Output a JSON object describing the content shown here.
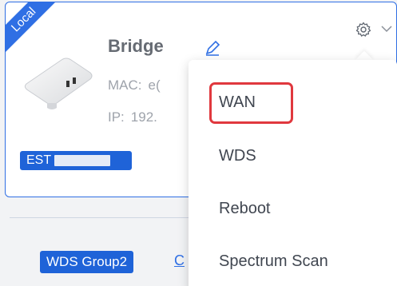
{
  "card": {
    "ribbon_label": "Local",
    "device_name": "Bridge",
    "mac_label": "MAC:",
    "mac_value": "e(",
    "ip_label": "IP:",
    "ip_value": "192.",
    "est_label": "EST"
  },
  "group": {
    "badge_label": "WDS Group2",
    "link_text": "C",
    "right_text": "£"
  },
  "menu": {
    "items": [
      {
        "label": "WAN"
      },
      {
        "label": "WDS"
      },
      {
        "label": "Reboot"
      },
      {
        "label": "Spectrum Scan"
      }
    ]
  },
  "icons": {
    "settings": "gear-icon",
    "expand": "chevron-down-icon",
    "edit": "pencil-icon"
  },
  "colors": {
    "accent": "#2f6fe4",
    "badge": "#1f63d8",
    "highlight": "#e0383e"
  }
}
